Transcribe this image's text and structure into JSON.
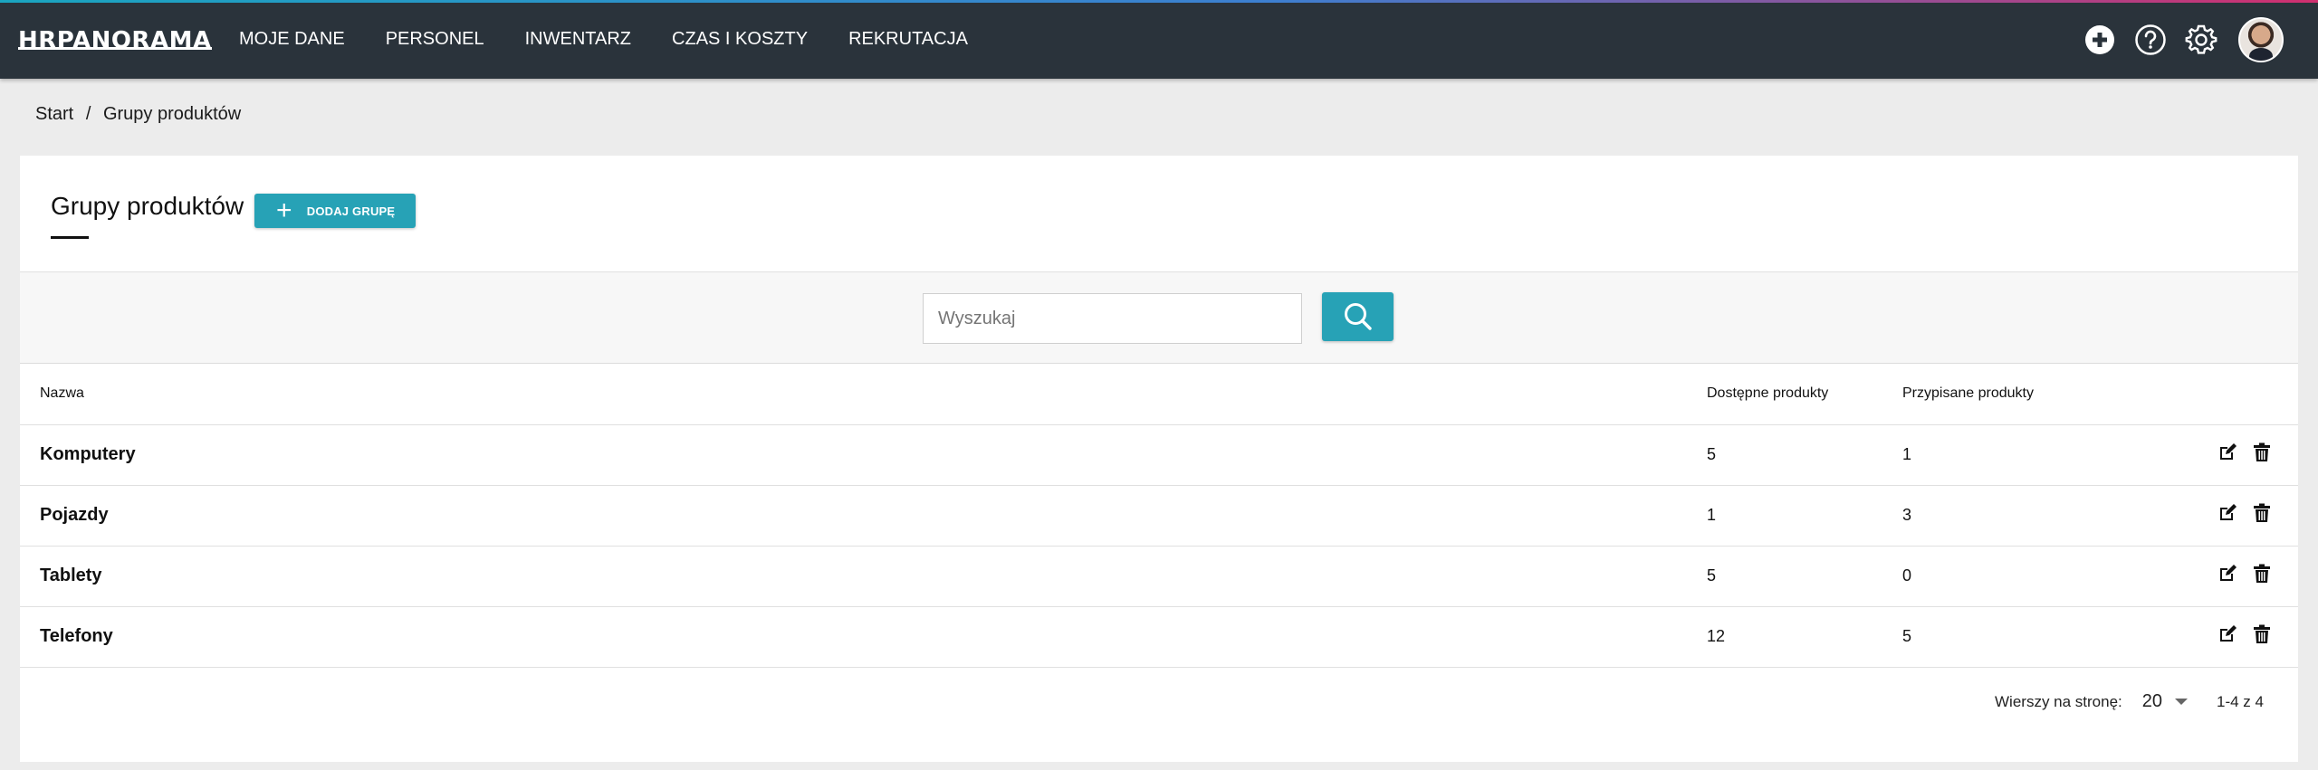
{
  "app": {
    "logo": "HRPANORAMA"
  },
  "nav": {
    "items": [
      {
        "label": "MOJE DANE"
      },
      {
        "label": "PERSONEL"
      },
      {
        "label": "INWENTARZ"
      },
      {
        "label": "CZAS I KOSZTY"
      },
      {
        "label": "REKRUTACJA"
      }
    ]
  },
  "topbar_icons": [
    "add-circle-icon",
    "help-icon",
    "settings-icon",
    "avatar"
  ],
  "breadcrumb": {
    "home": "Start",
    "separator": "/",
    "current": "Grupy produktów"
  },
  "page": {
    "title": "Grupy produktów",
    "add_button": "DODAJ GRUPĘ"
  },
  "search": {
    "placeholder": "Wyszukaj",
    "value": ""
  },
  "table": {
    "headers": {
      "name": "Nazwa",
      "available": "Dostępne produkty",
      "assigned": "Przypisane produkty"
    },
    "rows": [
      {
        "name": "Komputery",
        "available": "5",
        "assigned": "1"
      },
      {
        "name": "Pojazdy",
        "available": "1",
        "assigned": "3"
      },
      {
        "name": "Tablety",
        "available": "5",
        "assigned": "0"
      },
      {
        "name": "Telefony",
        "available": "12",
        "assigned": "5"
      }
    ]
  },
  "pagination": {
    "rows_per_page_label": "Wierszy na stronę:",
    "rows_per_page": "20",
    "range": "1-4 z 4"
  },
  "colors": {
    "topbar": "#2a333b",
    "accent": "#27a2b6",
    "background": "#ececec"
  }
}
